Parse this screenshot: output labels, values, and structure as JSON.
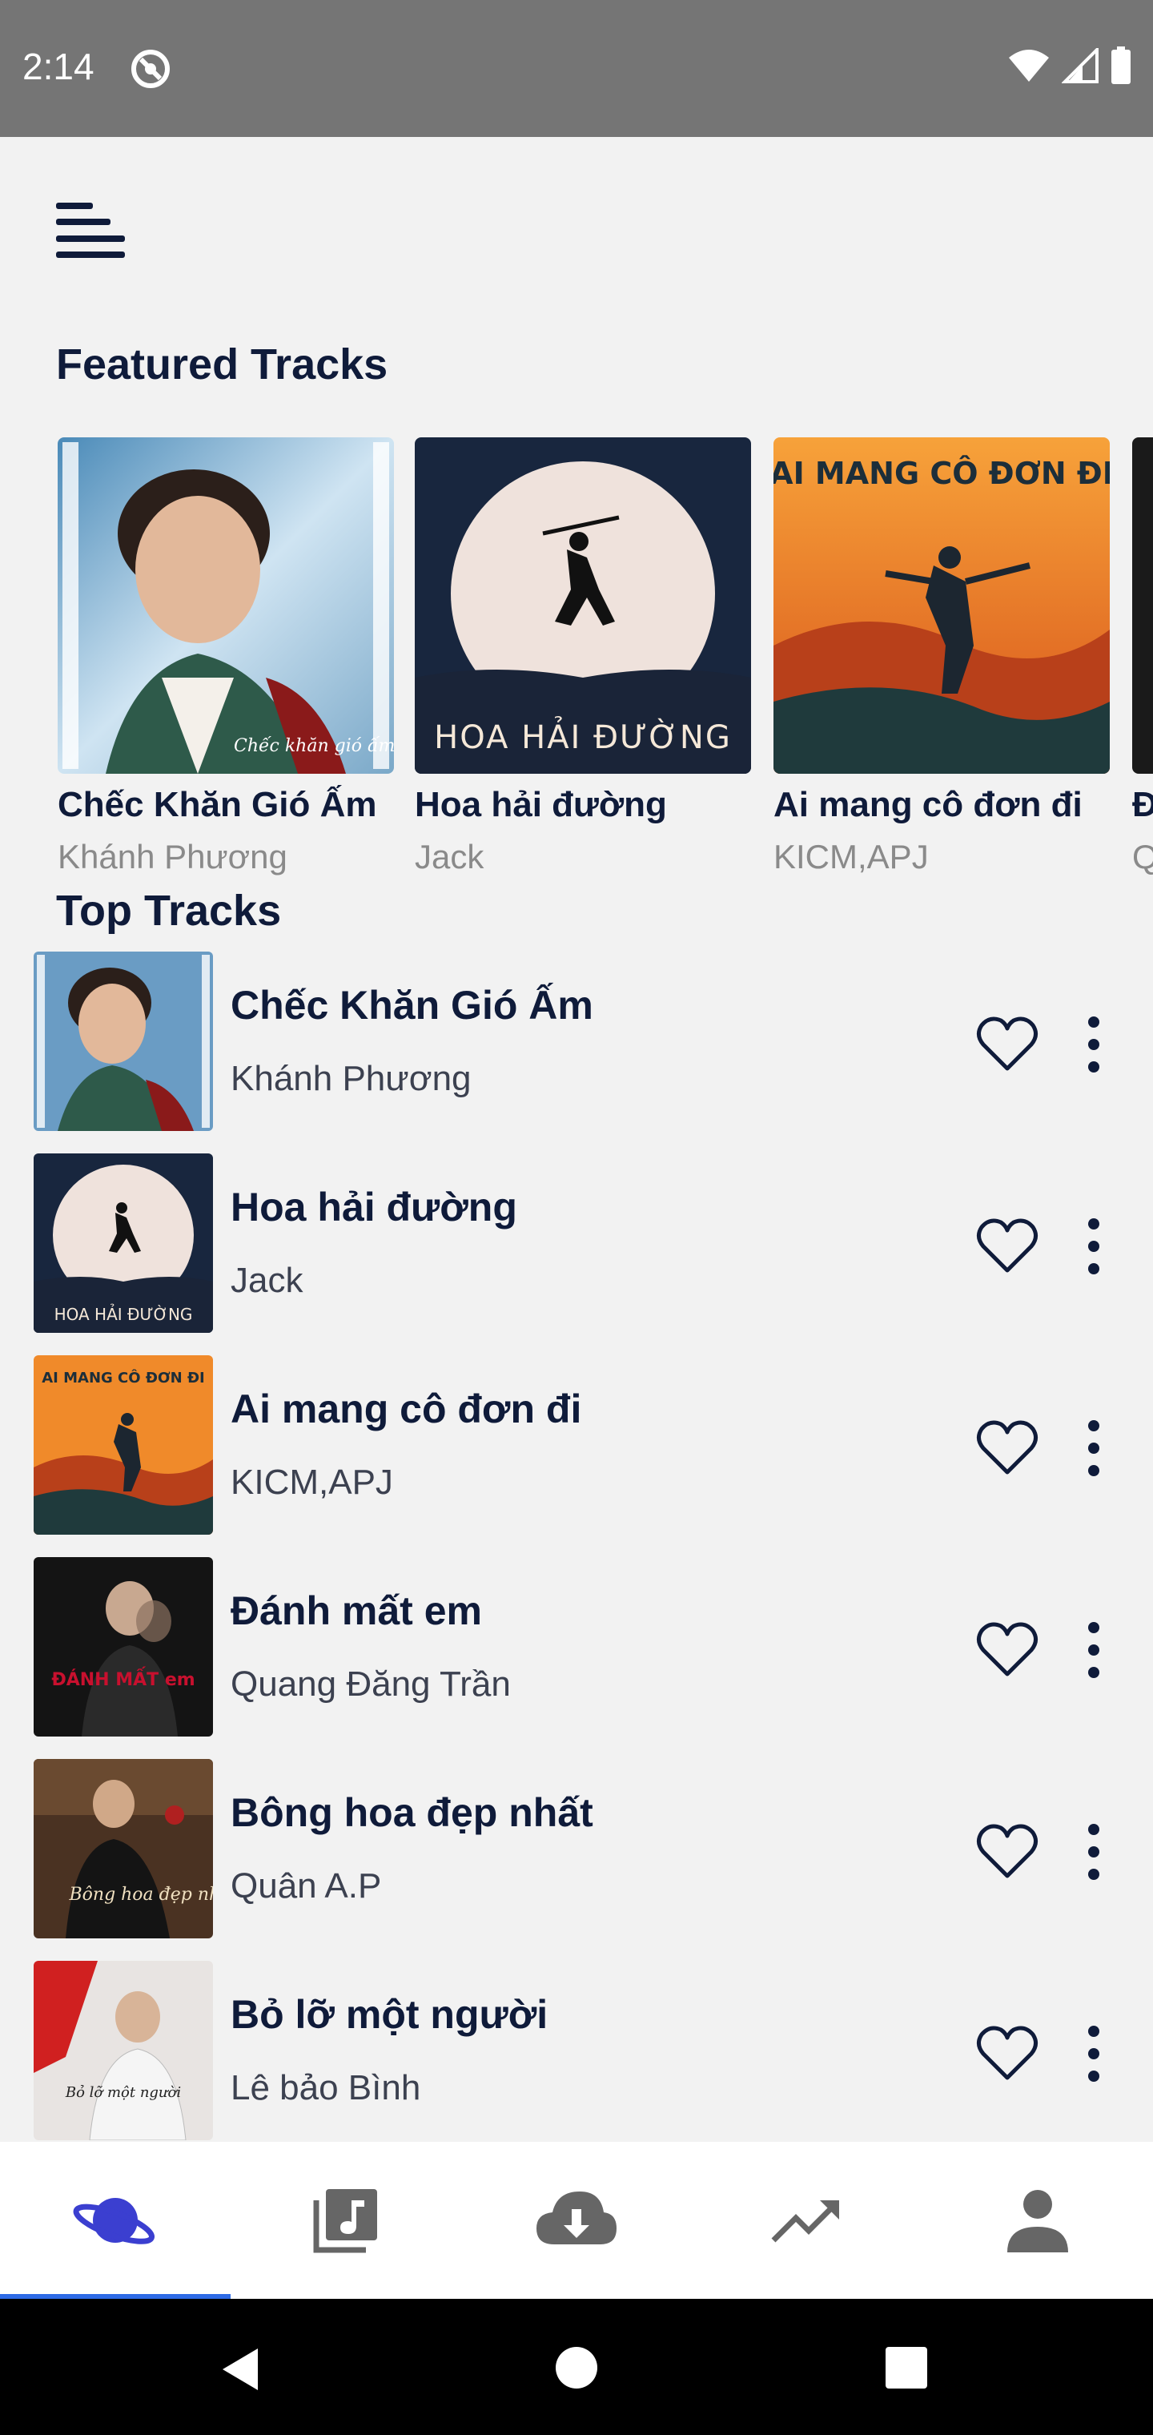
{
  "status_bar": {
    "time": "2:14"
  },
  "featured": {
    "title": "Featured Tracks",
    "items": [
      {
        "title": "Chếc Khăn Gió Ấm",
        "artist": "Khánh Phương",
        "cover_text": "Chếc khăn gió ấm"
      },
      {
        "title": "Hoa hải đường",
        "artist": "Jack",
        "cover_text": "HOA HẢI ĐƯỜNG"
      },
      {
        "title": "Ai mang cô đơn đi",
        "artist": "KICM,APJ",
        "cover_text": "AI MANG CÔ ĐƠN ĐI"
      },
      {
        "title": "Đ",
        "artist": "Q",
        "cover_text": ""
      }
    ]
  },
  "top": {
    "title": "Top Tracks",
    "items": [
      {
        "title": "Chếc Khăn Gió Ấm",
        "artist": "Khánh Phương",
        "cover_text": ""
      },
      {
        "title": "Hoa hải đường",
        "artist": "Jack",
        "cover_text": "HOA HẢI ĐƯỜNG"
      },
      {
        "title": "Ai mang cô đơn đi",
        "artist": "KICM,APJ",
        "cover_text": "AI MANG CÔ ĐƠN ĐI"
      },
      {
        "title": "Đánh mất em",
        "artist": "Quang Đăng Trần",
        "cover_text": "ĐÁNH MẤT em"
      },
      {
        "title": "Bông hoa đẹp nhất",
        "artist": "Quân A.P",
        "cover_text": "Bông hoa đẹp nhất"
      },
      {
        "title": "Bỏ lỡ một người",
        "artist": "Lê bảo Bình",
        "cover_text": "Bỏ lỡ một người"
      }
    ]
  },
  "colors": {
    "accent": "#3b3fd0",
    "text_dark": "#0f1b3a",
    "muted": "#8a8a8a",
    "indicator": "#2e6be6",
    "icon_gray": "#666666"
  },
  "bottom_nav": [
    {
      "icon": "planet-icon",
      "active": true
    },
    {
      "icon": "music-library-icon",
      "active": false
    },
    {
      "icon": "cloud-download-icon",
      "active": false
    },
    {
      "icon": "trending-icon",
      "active": false
    },
    {
      "icon": "person-icon",
      "active": false
    }
  ]
}
